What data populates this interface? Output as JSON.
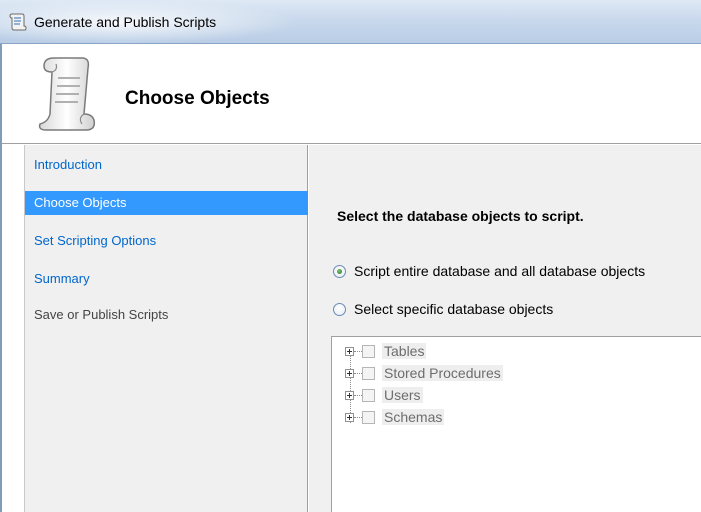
{
  "window": {
    "title": "Generate and Publish Scripts"
  },
  "header": {
    "title": "Choose Objects",
    "icon": "script-scroll-icon"
  },
  "sidebar": {
    "items": [
      {
        "label": "Introduction",
        "state": "link"
      },
      {
        "label": "Choose Objects",
        "state": "selected"
      },
      {
        "label": "Set Scripting Options",
        "state": "link"
      },
      {
        "label": "Summary",
        "state": "link"
      },
      {
        "label": "Save or Publish Scripts",
        "state": "disabled"
      }
    ]
  },
  "main": {
    "heading": "Select the database objects to script.",
    "options": [
      {
        "label": "Script entire database and all database objects",
        "checked": true
      },
      {
        "label": "Select specific database objects",
        "checked": false
      }
    ],
    "tree": [
      {
        "label": "Tables",
        "checked": false,
        "expanded": false
      },
      {
        "label": "Stored Procedures",
        "checked": false,
        "expanded": false
      },
      {
        "label": "Users",
        "checked": false,
        "expanded": false
      },
      {
        "label": "Schemas",
        "checked": false,
        "expanded": false
      }
    ]
  },
  "colors": {
    "selected_bg": "#3399ff",
    "link": "#0066cc",
    "panel_bg": "#f0f0f0",
    "titlebar": "#c9d9ec"
  }
}
